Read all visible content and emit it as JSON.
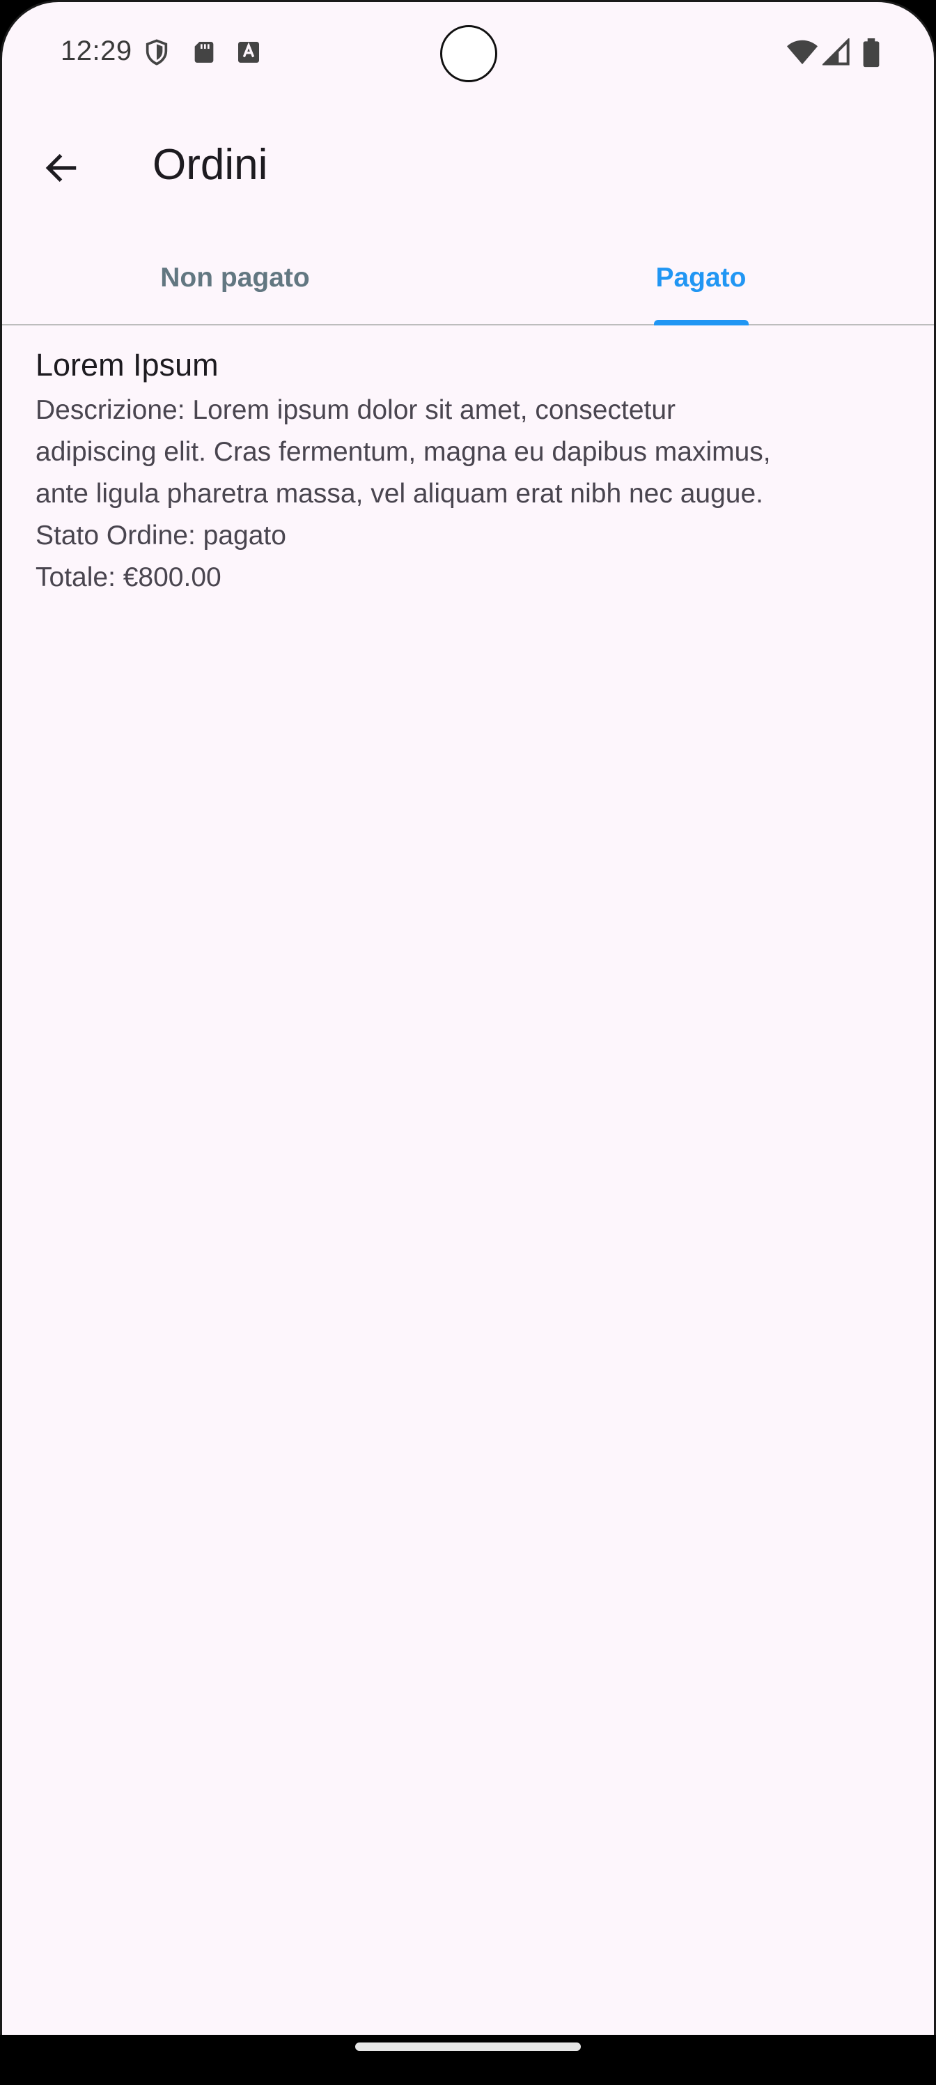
{
  "status_bar": {
    "time": "12:29",
    "left_icons": [
      "shield-icon",
      "sd-card-icon",
      "keyboard-a-icon"
    ],
    "right_icons": [
      "wifi-icon",
      "cell-signal-icon",
      "battery-icon"
    ]
  },
  "app_bar": {
    "title": "Ordini",
    "back_icon": "arrow-back-icon"
  },
  "tabs": [
    {
      "label": "Non pagato",
      "selected": false
    },
    {
      "label": "Pagato",
      "selected": true
    }
  ],
  "orders": [
    {
      "title": "Lorem Ipsum",
      "description_lines": [
        "Descrizione: Lorem ipsum dolor sit amet, consectetur",
        "adipiscing elit. Cras fermentum, magna eu dapibus maximus,",
        "ante ligula pharetra massa, vel aliquam erat nibh nec augue."
      ],
      "status": "Stato Ordine: pagato",
      "total": "Totale: €800.00"
    }
  ],
  "colors": {
    "background": "#fdf6fc",
    "accent": "#2196f3",
    "inactive_tab": "#627781",
    "text_primary": "#1d1b20",
    "text_secondary": "#49454f"
  }
}
